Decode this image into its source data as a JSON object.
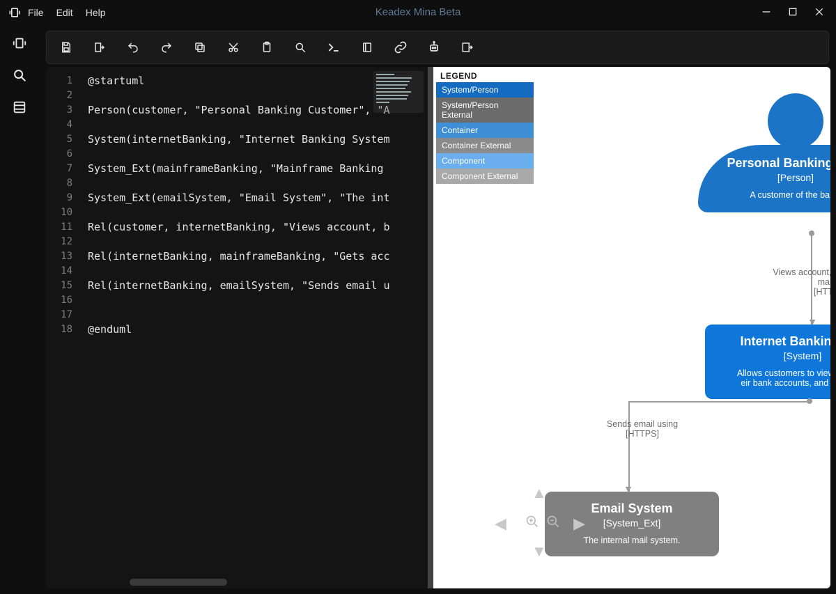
{
  "app": {
    "title": "Keadex Mina Beta"
  },
  "menu": {
    "file": "File",
    "edit": "Edit",
    "help": "Help"
  },
  "sidebar_icons": [
    "panel-icon",
    "search-icon",
    "library-icon"
  ],
  "toolbar_icons": [
    "save-icon",
    "export-icon",
    "undo-icon",
    "redo-icon",
    "copy-icon",
    "cut-icon",
    "paste-icon",
    "search-icon",
    "terminal-icon",
    "book-icon",
    "link-icon",
    "ai-icon",
    "exit-icon"
  ],
  "editor": {
    "lines": [
      "@startuml",
      "",
      "Person(customer, \"Personal Banking Customer\", \"A",
      "",
      "System(internetBanking, \"Internet Banking System",
      "",
      "System_Ext(mainframeBanking, \"Mainframe Banking",
      "",
      "System_Ext(emailSystem, \"Email System\", \"The int",
      "",
      "Rel(customer, internetBanking, \"Views account, b",
      "",
      "Rel(internetBanking, mainframeBanking, \"Gets acc",
      "",
      "Rel(internetBanking, emailSystem, \"Sends email u",
      "",
      "",
      "@enduml"
    ]
  },
  "legend": {
    "title": "LEGEND",
    "rows": [
      "System/Person",
      "System/Person External",
      "Container",
      "Container External",
      "Component",
      "Component External"
    ]
  },
  "diagram": {
    "person": {
      "title": "Personal Banking Cust",
      "type": "[Person]",
      "desc": "A customer of the bank."
    },
    "rel1": {
      "label": "Views account, balances, and makes",
      "proto": "[HTTPS]"
    },
    "system": {
      "title": "Internet Banking Sys",
      "type": "[System]",
      "desc": "Allows customers to view informat\neir bank accounts, and make pa"
    },
    "rel2": {
      "label": "Sends email using",
      "proto": "[HTTPS]"
    },
    "ext": {
      "title": "Email System",
      "type": "[System_Ext]",
      "desc": "The internal mail system."
    }
  }
}
